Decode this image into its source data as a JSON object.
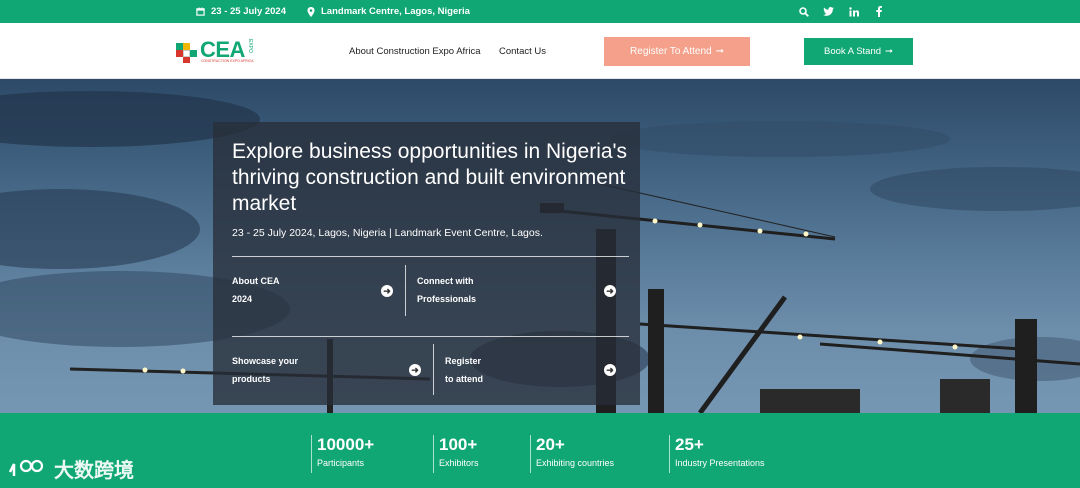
{
  "topbar": {
    "date": "23 - 25 July 2024",
    "venue": "Landmark Centre, Lagos, Nigeria",
    "icons": [
      "search-icon",
      "twitter-icon",
      "linkedin-icon",
      "facebook-icon"
    ]
  },
  "header": {
    "logo_text": "CEA",
    "logo_sub": "CONSTRUCTION EXPO AFRICA",
    "logo_expo": "EXPO",
    "nav": [
      "About Construction Expo Africa",
      "Contact Us"
    ],
    "register_label": "Register To Attend",
    "book_label": "Book A Stand"
  },
  "hero": {
    "headline": "Explore business opportunities in Nigeria's thriving construction and built environment market",
    "subline": "23 - 25 July 2024, Lagos, Nigeria | Landmark Event Centre, Lagos.",
    "links": [
      {
        "line1": "About CEA",
        "line2": "2024"
      },
      {
        "line1": "Connect with",
        "line2": "Professionals"
      },
      {
        "line1": "Showcase your",
        "line2": "products"
      },
      {
        "line1": "Register",
        "line2": "to attend"
      }
    ]
  },
  "stats": [
    {
      "value": "10000+",
      "label": "Participants"
    },
    {
      "value": "100+",
      "label": "Exhibitors"
    },
    {
      "value": "20+",
      "label": "Exhibiting countries"
    },
    {
      "value": "25+",
      "label": "Industry Presentations"
    }
  ],
  "watermark": "大数跨境",
  "colors": {
    "brand_green": "#10a774",
    "register_salmon": "#f4a08a",
    "panel_dark": "#282e38"
  }
}
